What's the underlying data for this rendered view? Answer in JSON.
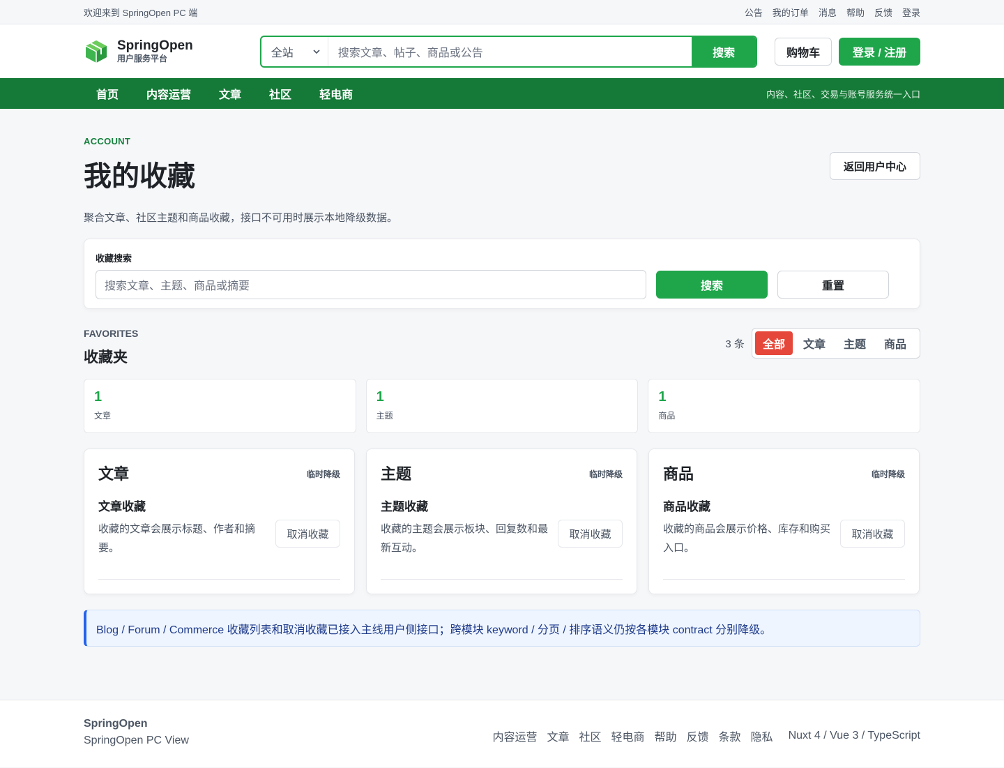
{
  "topbar": {
    "welcome": "欢迎来到 SpringOpen PC 端",
    "links": [
      "公告",
      "我的订单",
      "消息",
      "帮助",
      "反馈",
      "登录"
    ]
  },
  "header": {
    "brand_name": "SpringOpen",
    "brand_sub": "用户服务平台",
    "search_scope": "全站",
    "search_placeholder": "搜索文章、帖子、商品或公告",
    "search_button": "搜索",
    "cart_button": "购物车",
    "login_button": "登录 / 注册"
  },
  "nav": {
    "items": [
      "首页",
      "内容运营",
      "文章",
      "社区",
      "轻电商"
    ],
    "tagline": "内容、社区、交易与账号服务统一入口"
  },
  "page": {
    "eyebrow": "ACCOUNT",
    "title": "我的收藏",
    "back_button": "返回用户中心",
    "description": "聚合文章、社区主题和商品收藏，接口不可用时展示本地降级数据。"
  },
  "fav_search": {
    "label": "收藏搜索",
    "placeholder": "搜索文章、主题、商品或摘要",
    "search_button": "搜索",
    "reset_button": "重置"
  },
  "favorites": {
    "eyebrow": "FAVORITES",
    "title": "收藏夹",
    "count_text": "3 条",
    "filters": [
      "全部",
      "文章",
      "主题",
      "商品"
    ],
    "active_filter": "全部"
  },
  "stats": [
    {
      "num": "1",
      "label": "文章"
    },
    {
      "num": "1",
      "label": "主题"
    },
    {
      "num": "1",
      "label": "商品"
    }
  ],
  "categories": [
    {
      "title": "文章",
      "badge": "临时降级",
      "item_title": "文章收藏",
      "item_desc": "收藏的文章会展示标题、作者和摘要。",
      "action": "取消收藏"
    },
    {
      "title": "主题",
      "badge": "临时降级",
      "item_title": "主题收藏",
      "item_desc": "收藏的主题会展示板块、回复数和最新互动。",
      "action": "取消收藏"
    },
    {
      "title": "商品",
      "badge": "临时降级",
      "item_title": "商品收藏",
      "item_desc": "收藏的商品会展示价格、库存和购买入口。",
      "action": "取消收藏"
    }
  ],
  "notice": "Blog / Forum / Commerce 收藏列表和取消收藏已接入主线用户侧接口；跨模块 keyword / 分页 / 排序语义仍按各模块 contract 分别降级。",
  "footer": {
    "brand": "SpringOpen",
    "view": "SpringOpen PC View",
    "links": [
      "内容运营",
      "文章",
      "社区",
      "轻电商",
      "帮助",
      "反馈",
      "条款",
      "隐私"
    ],
    "tech": "Nuxt 4 / Vue 3 / TypeScript"
  },
  "colors": {
    "primary": "#1fa64b",
    "nav_bg": "#157a37",
    "active_filter": "#e5483b",
    "notice_border": "#2563eb"
  }
}
